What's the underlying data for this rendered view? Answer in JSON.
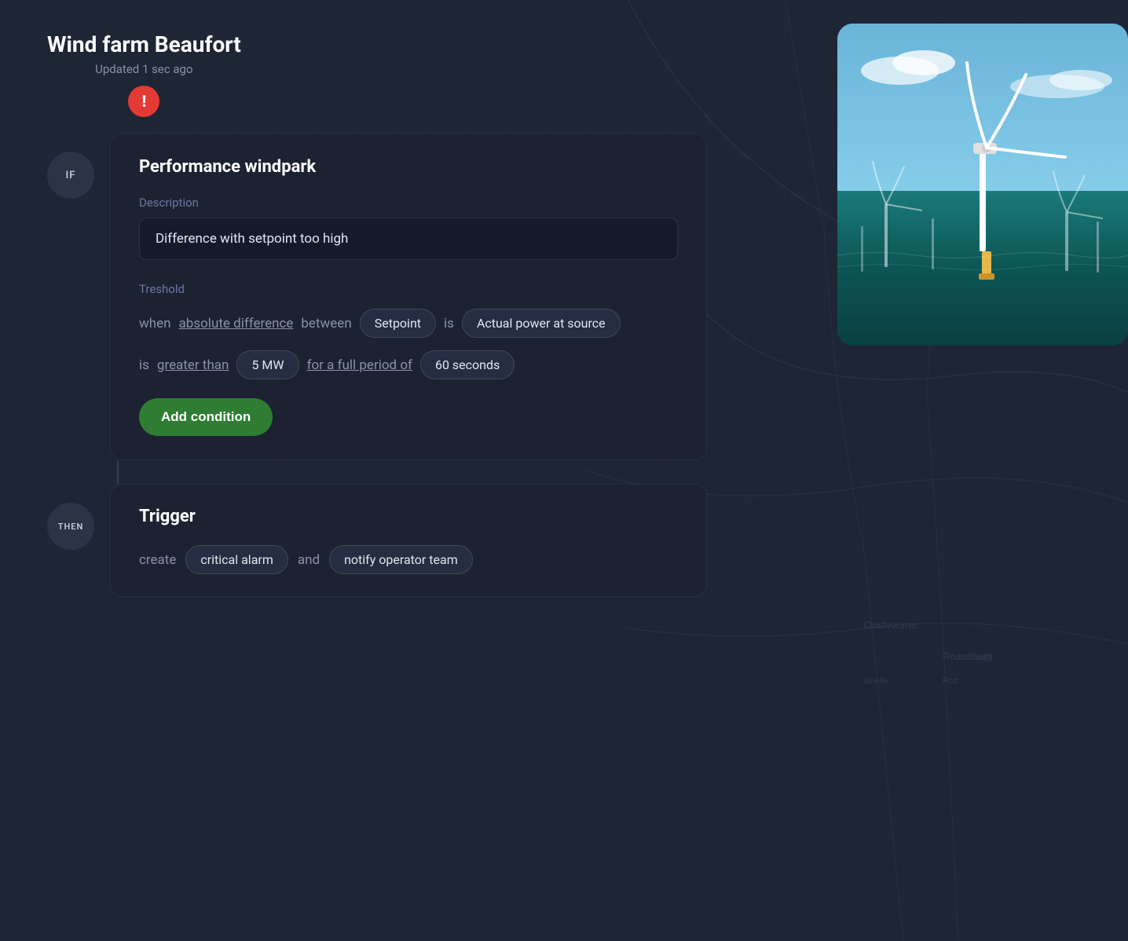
{
  "header": {
    "farm_name": "Wind farm Beaufort",
    "updated": "Updated 1 sec ago",
    "alert_icon": "!"
  },
  "if_section": {
    "badge_label": "IF",
    "card": {
      "title": "Performance windpark",
      "description_label": "Description",
      "description_value": "Difference with setpoint too high",
      "threshold_label": "Treshold",
      "threshold": {
        "when": "when",
        "absolute_difference": "absolute difference",
        "between": "between",
        "setpoint_pill": "Setpoint",
        "is1": "is",
        "actual_power_pill": "Actual power at source",
        "is2": "is",
        "greater_than": "greater than",
        "mw_pill": "5 MW",
        "for_full_period": "for a full period of",
        "seconds_pill": "60 seconds"
      },
      "add_condition_label": "Add condition"
    }
  },
  "then_section": {
    "badge_label": "THEN",
    "card": {
      "title": "Trigger",
      "create_text": "create",
      "critical_alarm_pill": "critical alarm",
      "and_text": "and",
      "notify_pill": "notify operator team"
    }
  }
}
